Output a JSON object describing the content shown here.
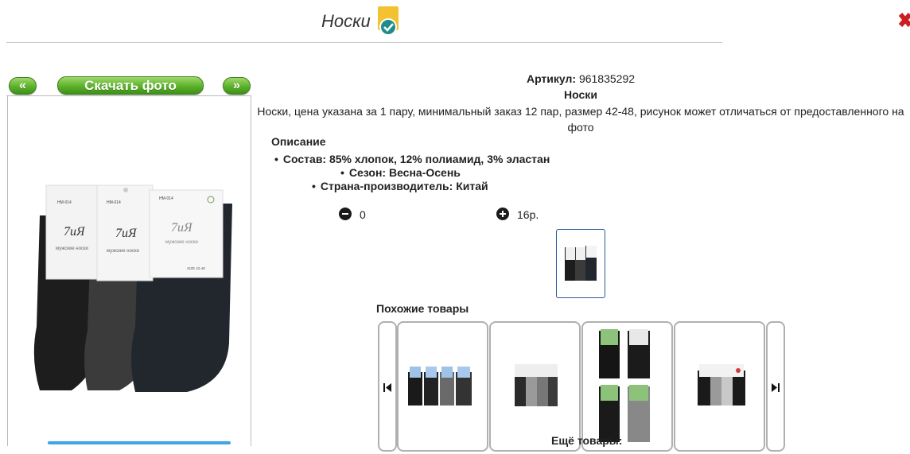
{
  "header": {
    "title": "Носки"
  },
  "nav": {
    "prev_label": "«",
    "download_label": "Скачать фото",
    "next_label": "»"
  },
  "product": {
    "article_label": "Артикул:",
    "article_value": "961835292",
    "name": "Носки",
    "description": "Носки, цена указана за 1 пару, минимальный заказ 12 пар, размер 42-48, рисунок может отличаться от предоставленного на фото",
    "photo_tag_code": "НМ-014",
    "photo_brand": "7иЯ",
    "photo_caption": "мужские носки",
    "photo_size": "SIZE 42-48"
  },
  "description_section": {
    "heading": "Описание",
    "items": [
      "Состав: 85% хлопок, 12% полиамид, 3% эластан",
      "Сезон: Весна-Осень",
      "Страна-производитель: Китай"
    ]
  },
  "quantity": {
    "value": "0",
    "price": "16р."
  },
  "similar": {
    "heading": "Похожие товары"
  },
  "more": {
    "heading": "Ещё товары:"
  },
  "colors": {
    "green_button": "#5bb12a",
    "badge_yellow": "#f2c230",
    "badge_teal": "#1e8c8c",
    "close_red": "#cc1f1f",
    "thumb_border": "#2a5a9a"
  }
}
